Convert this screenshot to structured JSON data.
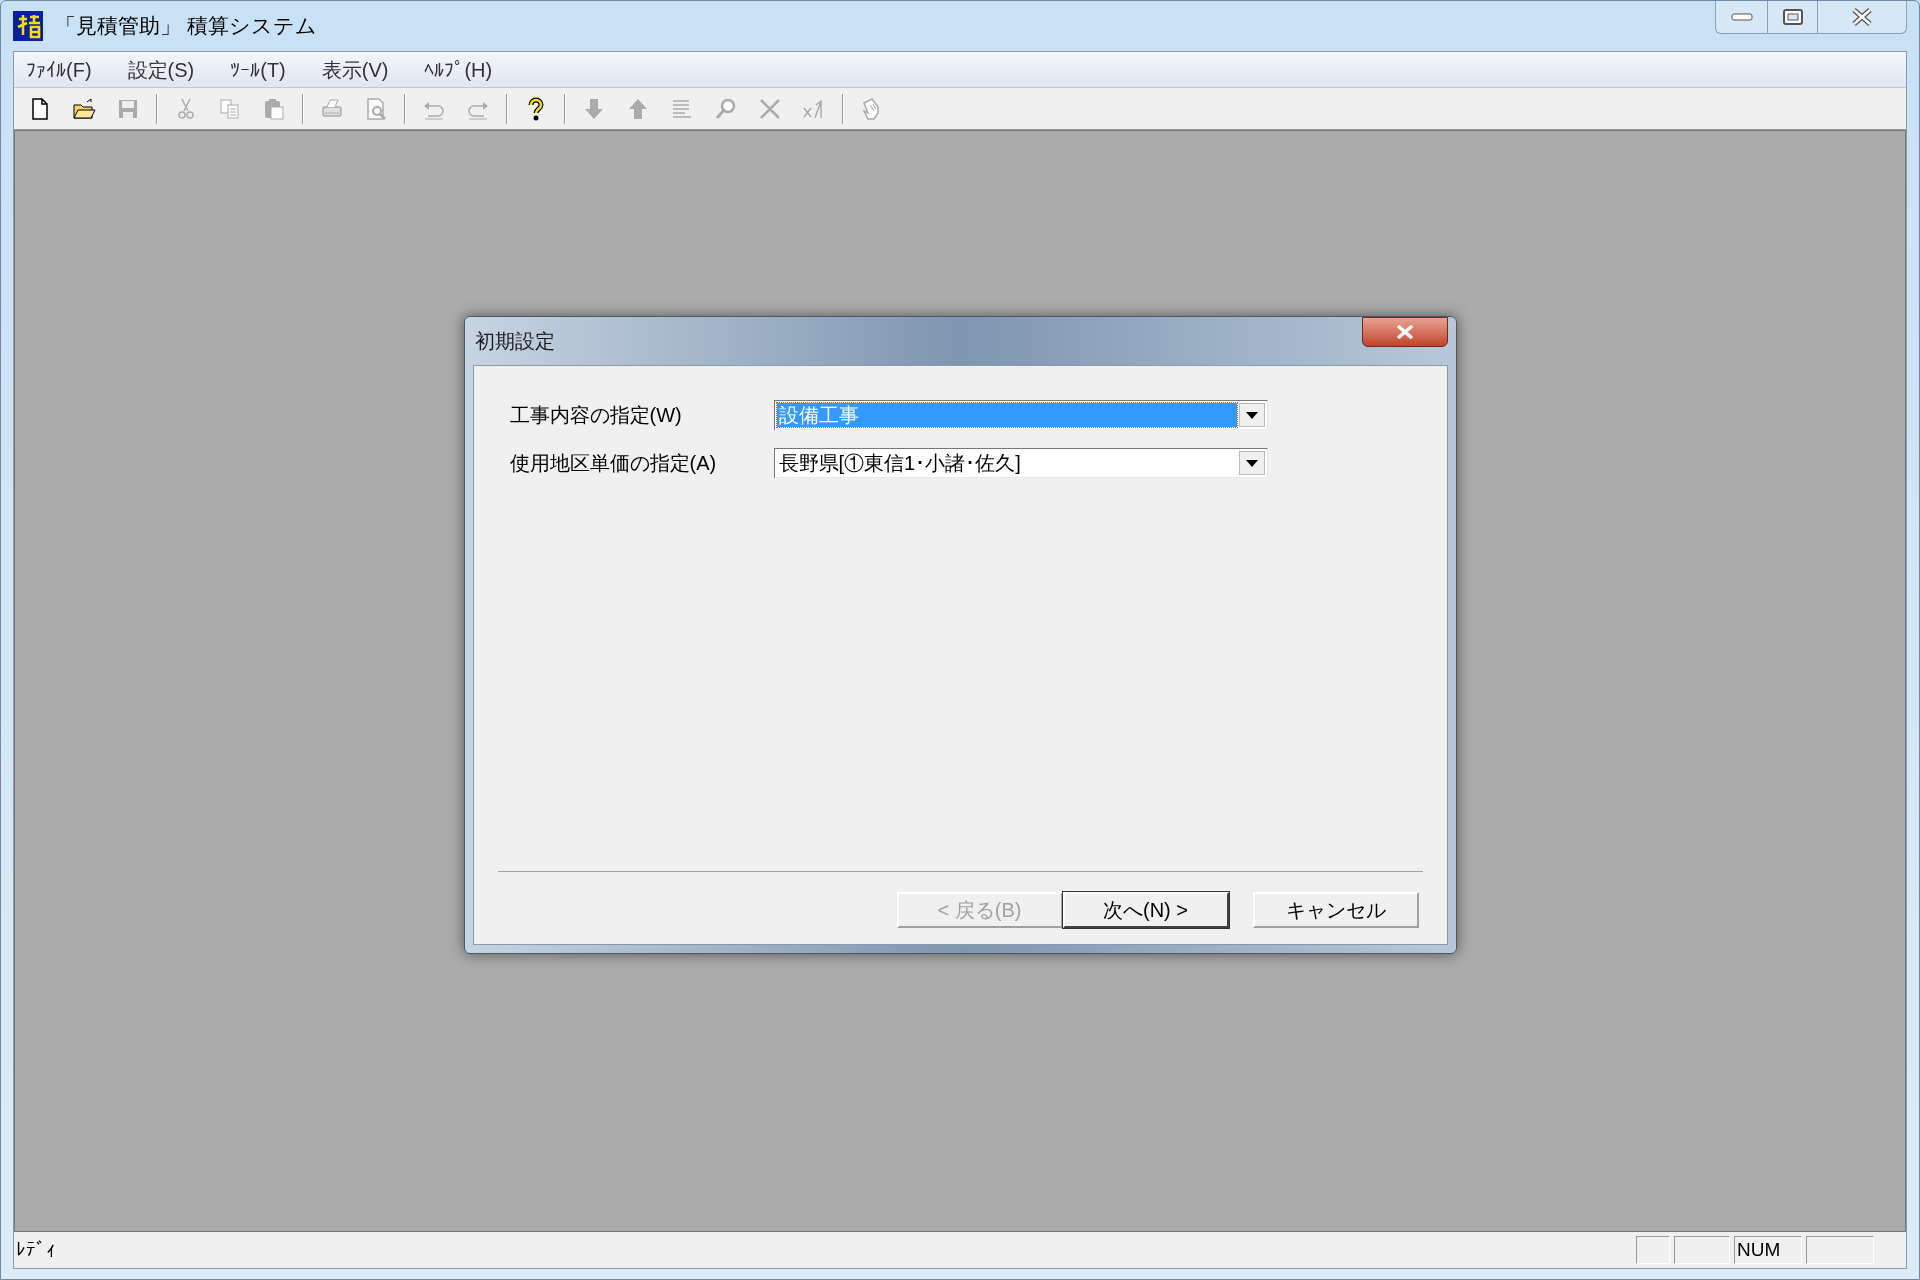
{
  "window": {
    "title": "「見積管助」 積算システム"
  },
  "menu": [
    "ﾌｧｲﾙ(F)",
    "設定(S)",
    "ﾂｰﾙ(T)",
    "表示(V)",
    "ﾍﾙﾌﾟ(H)"
  ],
  "toolbar": [
    {
      "kind": "new",
      "disabled": false
    },
    {
      "kind": "open",
      "disabled": false
    },
    {
      "kind": "save",
      "disabled": true
    },
    {
      "kind": "sep"
    },
    {
      "kind": "cut",
      "disabled": true
    },
    {
      "kind": "copy",
      "disabled": true
    },
    {
      "kind": "paste",
      "disabled": true
    },
    {
      "kind": "sep"
    },
    {
      "kind": "print",
      "disabled": true
    },
    {
      "kind": "preview",
      "disabled": true
    },
    {
      "kind": "sep"
    },
    {
      "kind": "undo",
      "disabled": true
    },
    {
      "kind": "redo",
      "disabled": true
    },
    {
      "kind": "sep"
    },
    {
      "kind": "help",
      "disabled": false
    },
    {
      "kind": "sep"
    },
    {
      "kind": "down",
      "disabled": true
    },
    {
      "kind": "up",
      "disabled": true
    },
    {
      "kind": "list",
      "disabled": true
    },
    {
      "kind": "find",
      "disabled": true
    },
    {
      "kind": "delete",
      "disabled": true
    },
    {
      "kind": "formula",
      "disabled": true
    },
    {
      "kind": "sep"
    },
    {
      "kind": "pointer",
      "disabled": true
    }
  ],
  "dialog": {
    "title": "初期設定",
    "fields": [
      {
        "label": "工事内容の指定(W)",
        "value": "設備工事",
        "focused": true
      },
      {
        "label": "使用地区単価の指定(A)",
        "value": "長野県[①東信1･小諸･佐久]",
        "focused": false
      }
    ],
    "buttons": [
      {
        "label": "< 戻る(B)",
        "disabled": true,
        "default": false
      },
      {
        "label": "次へ(N) >",
        "disabled": false,
        "default": true
      },
      {
        "label": "キャンセル",
        "disabled": false,
        "default": false
      }
    ]
  },
  "status_bar": {
    "text": "ﾚﾃﾞｨ",
    "indicators": [
      "NUM"
    ]
  }
}
